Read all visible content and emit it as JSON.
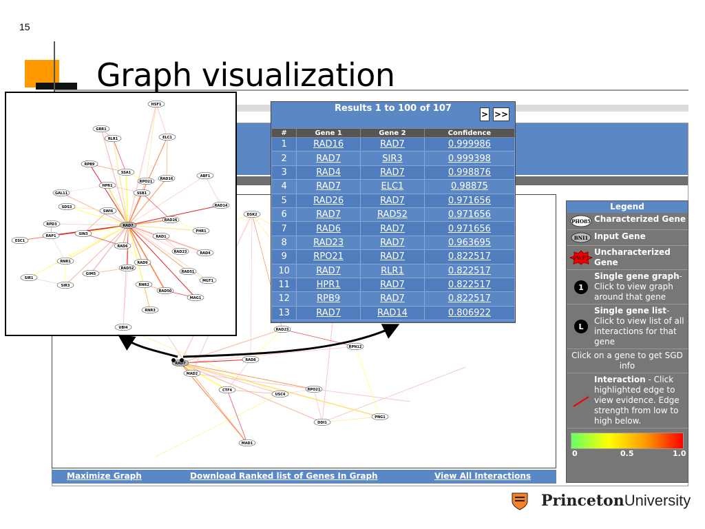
{
  "slide": {
    "number": "15",
    "title": "Graph visualization"
  },
  "results": {
    "heading": "Results 1 to 100 of 107",
    "next_label": ">",
    "last_label": ">>",
    "columns": [
      "#",
      "Gene 1",
      "Gene 2",
      "Confidence"
    ],
    "rows": [
      [
        "1",
        "RAD16",
        "RAD7",
        "0.999986"
      ],
      [
        "2",
        "RAD7",
        "SIR3",
        "0.999398"
      ],
      [
        "3",
        "RAD4",
        "RAD7",
        "0.998876"
      ],
      [
        "4",
        "RAD7",
        "ELC1",
        "0.98875"
      ],
      [
        "5",
        "RAD26",
        "RAD7",
        "0.971656"
      ],
      [
        "6",
        "RAD7",
        "RAD52",
        "0.971656"
      ],
      [
        "7",
        "RAD6",
        "RAD7",
        "0.971656"
      ],
      [
        "8",
        "RAD23",
        "RAD7",
        "0.963695"
      ],
      [
        "9",
        "RPO21",
        "RAD7",
        "0.822517"
      ],
      [
        "10",
        "RAD7",
        "RLR1",
        "0.822517"
      ],
      [
        "11",
        "HPR1",
        "RAD7",
        "0.822517"
      ],
      [
        "12",
        "RPB9",
        "RAD7",
        "0.822517"
      ],
      [
        "13",
        "RAD7",
        "RAD14",
        "0.806922"
      ]
    ]
  },
  "legend": {
    "title": "Legend",
    "items": [
      {
        "icon_label": "PHO85",
        "text": "Characterized Gene"
      },
      {
        "icon_label": "BNI1",
        "text": "Input Gene"
      },
      {
        "icon_label": "PWP1",
        "text": "Uncharacterized Gene"
      },
      {
        "icon_label": "1",
        "bold": "Single gene graph",
        "text": "- Click to view graph around that gene"
      },
      {
        "icon_label": "L",
        "bold": "Single gene list",
        "text": "- Click to view list of all interactions for that gene"
      }
    ],
    "info": "Click on a gene to get SGD info",
    "interaction_bold": "Interaction",
    "interaction_text": " - Click highlighted edge to view evidence. Edge strength from low to high below.",
    "scale": {
      "min": "0",
      "mid": "0.5",
      "max": "1.0"
    }
  },
  "bottom_links": {
    "maximize": "Maximize Graph",
    "download": "Download Ranked list of Genes In Graph",
    "view_all": "View All Interactions"
  },
  "main_graph_nodes": [
    "DSK2",
    "RAD23",
    "RAD7",
    "MAD2",
    "RAD8",
    "CTF4",
    "USC4",
    "RPO21",
    "RPN12",
    "DDI1",
    "PNG1",
    "MAD1"
  ],
  "inset_graph_nodes": [
    "HSF1",
    "GRR1",
    "RLR1",
    "ELC1",
    "RPB9",
    "SSA1",
    "RPO21",
    "RAD16",
    "ABF1",
    "GAL11",
    "HPR1",
    "SSB1",
    "RAD14",
    "SDS3",
    "SWI6",
    "RAD26",
    "RPD3",
    "RAD7",
    "PHR1",
    "ESC1",
    "RAP1",
    "SIN3",
    "RAD1",
    "RAD6",
    "RAD23",
    "RAD4",
    "RNR1",
    "RAD9",
    "RAD52",
    "SIR1",
    "GIM5",
    "RAD51",
    "MGT1",
    "SIR3",
    "RNR2",
    "RAD50",
    "MAG1",
    "RNR3",
    "UBI4"
  ],
  "branding": {
    "part1": "Princeton",
    "part2": "University"
  }
}
